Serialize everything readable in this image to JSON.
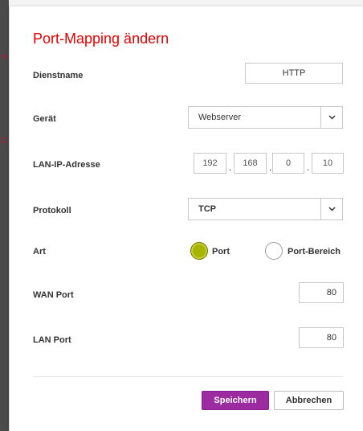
{
  "dialog": {
    "title": "Port-Mapping ändern"
  },
  "fields": {
    "service_name": {
      "label": "Dienstname",
      "value": "HTTP"
    },
    "device": {
      "label": "Gerät",
      "selected": "Webserver"
    },
    "lan_ip": {
      "label": "LAN-IP-Adresse",
      "octets": [
        "192",
        "168",
        "0",
        "10"
      ]
    },
    "protocol": {
      "label": "Protokoll",
      "selected": "TCP"
    },
    "type": {
      "label": "Art",
      "options": [
        "Port",
        "Port-Bereich"
      ],
      "selected": "Port"
    },
    "wan_port": {
      "label": "WAN Port",
      "value": "80"
    },
    "lan_port": {
      "label": "LAN Port",
      "value": "80"
    }
  },
  "buttons": {
    "save": "Speichern",
    "cancel": "Abbrechen"
  },
  "colors": {
    "title": "#e60000",
    "radio_selected": "#a8b400",
    "primary_button": "#9c2aa0"
  },
  "icons": {
    "select_caret": "chevron-down-icon"
  }
}
